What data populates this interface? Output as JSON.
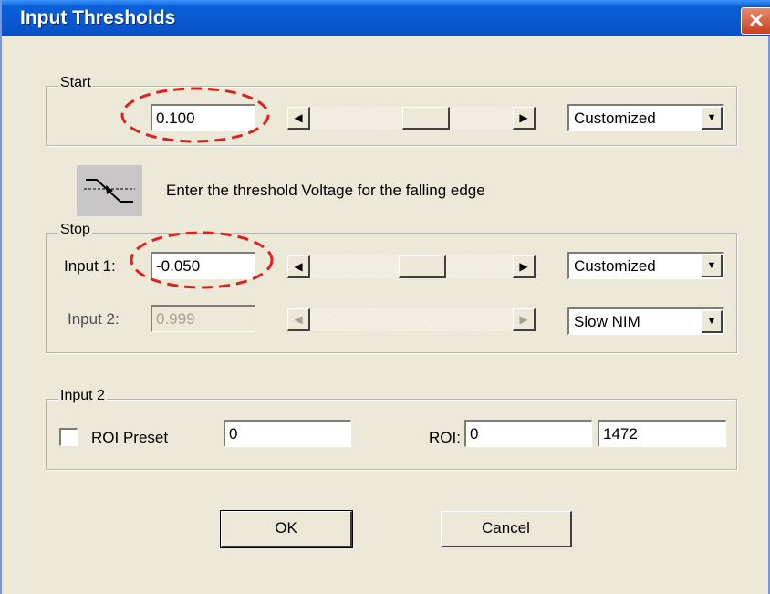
{
  "window": {
    "title": "Input Thresholds",
    "close_glyph": "✕"
  },
  "start": {
    "legend": "Start",
    "value": "0.100",
    "mode": "Customized"
  },
  "hint": {
    "icon": "falling-edge-icon",
    "text": "Enter the threshold Voltage for the falling edge"
  },
  "stop": {
    "legend": "Stop",
    "input1_label": "Input 1:",
    "input1_value": "-0.050",
    "input1_mode": "Customized",
    "input2_label": "Input 2:",
    "input2_value": "0.999",
    "input2_mode": "Slow NIM"
  },
  "input2_group": {
    "legend": "Input 2",
    "roi_preset_label": "ROI Preset",
    "roi_preset_checked": false,
    "roi_preset_value": "0",
    "roi_label": "ROI:",
    "roi_from": "0",
    "roi_to": "1472"
  },
  "buttons": {
    "ok": "OK",
    "cancel": "Cancel"
  },
  "colors": {
    "annotation": "#e02020",
    "title_bar": "#0a58d0"
  }
}
